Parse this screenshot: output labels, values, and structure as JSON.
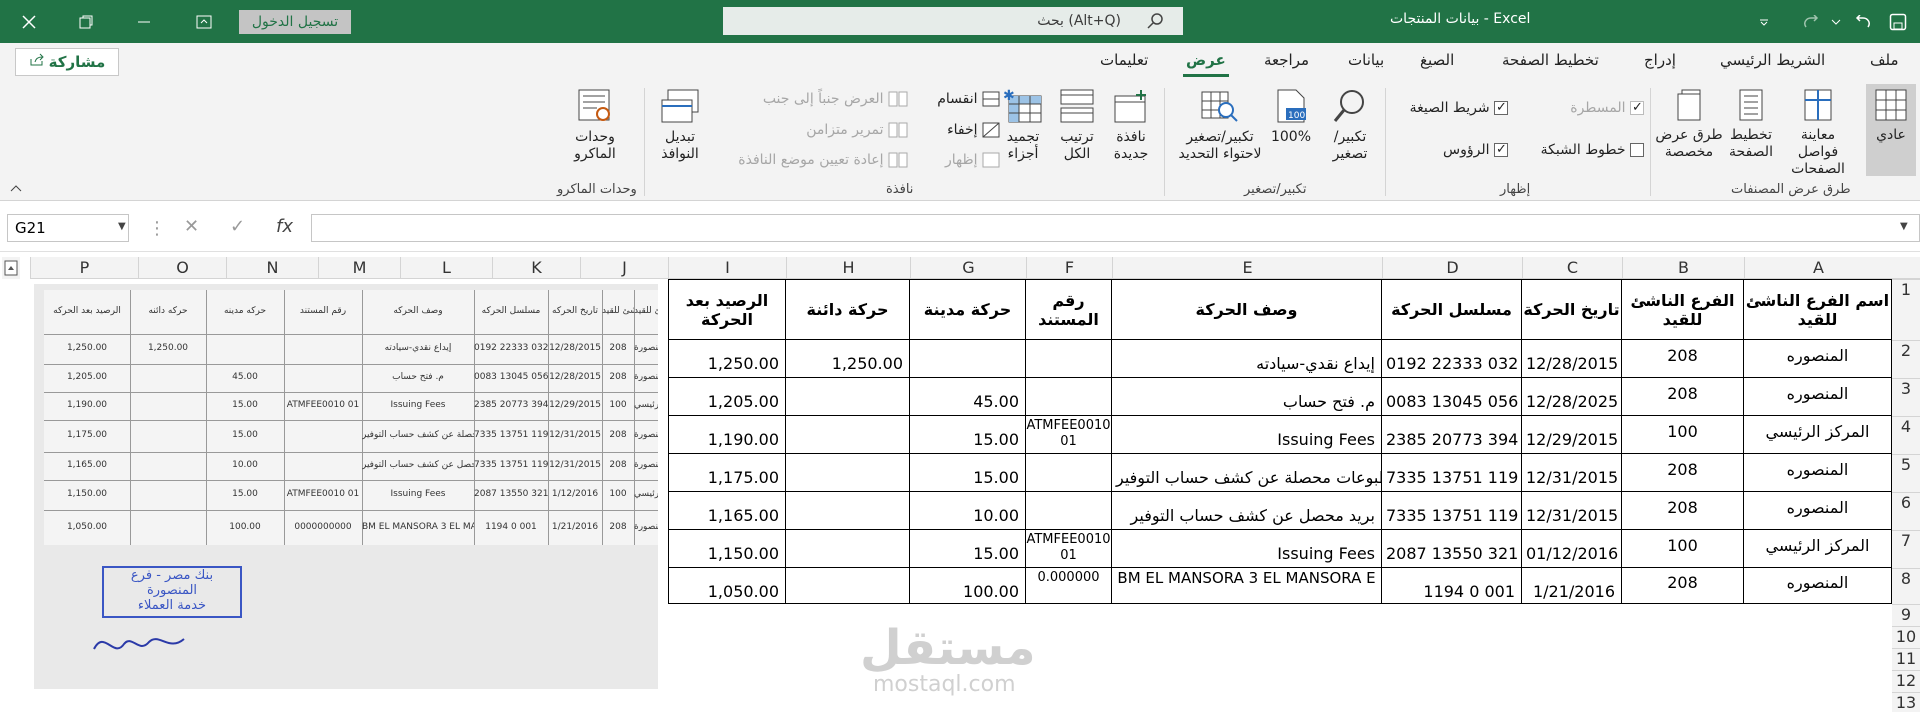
{
  "titlebar": {
    "title": "بيانات المنتجات  -  Excel",
    "search_text": "بحث (Alt+Q)",
    "login_label": "تسجيل الدخول"
  },
  "share_label": "مشاركة",
  "tabs": [
    {
      "label": "ملف"
    },
    {
      "label": "الشريط الرئيسي"
    },
    {
      "label": "إدراج"
    },
    {
      "label": "تخطيط الصفحة"
    },
    {
      "label": "الصيغ"
    },
    {
      "label": "بيانات"
    },
    {
      "label": "مراجعة"
    },
    {
      "label": "عرض"
    },
    {
      "label": "تعليمات"
    }
  ],
  "ribbon": {
    "normal": "عادي",
    "page_break": "معاينة فواصل الصفحات",
    "page_layout": "تخطيط الصفحة",
    "custom_views": "طرق عرض مخصصة",
    "group_views": "طرق عرض المصنفات",
    "ruler": "المسطرة",
    "formula_bar": "شريط الصيغة",
    "gridlines": "خطوط الشبكة",
    "headings": "الرؤوس",
    "group_show": "إظهار",
    "zoom": "تكبير/ تصغير",
    "zoom100": "100%",
    "zoom_selection": "تكبير/تصغير لاحتواء التحديد",
    "group_zoom": "تكبير/تصغير",
    "new_window": "نافذة جديدة",
    "arrange_all": "ترتيب الكل",
    "freeze": "تجميد أجزاء",
    "split": "انقسام",
    "hide": "إخفاء",
    "unhide": "إظهار",
    "side_by_side": "العرض جنباً إلى جنب",
    "sync_scroll": "تمرير متزامن",
    "reset_pos": "إعادة تعيين موضع النافذة",
    "switch_windows": "تبديل النوافذ",
    "group_window": "نافذة",
    "macros": "وحدات الماكرو",
    "group_macros": "وحدات الماكرو"
  },
  "namebox": "G21",
  "columns": [
    "A",
    "B",
    "C",
    "D",
    "E",
    "F",
    "G",
    "H",
    "I",
    "J",
    "K",
    "L",
    "M",
    "N",
    "O",
    "P"
  ],
  "rows": [
    "1",
    "2",
    "3",
    "4",
    "5",
    "6",
    "7",
    "8",
    "9",
    "10",
    "11",
    "12",
    "13"
  ],
  "table": {
    "headers": [
      "اسم الفرع الناشئ للقيد",
      "الفرع الناشئ للقيد",
      "تاريخ الحركة",
      "مسلسل الحركة",
      "وصف الحركة",
      "رقم المستند",
      "حركة مدينة",
      "حركة دائنة",
      "الرصيد بعد الحركة"
    ],
    "rows": [
      [
        "المنصوره",
        "208",
        "12/28/2015",
        "0192 22333 032",
        "إيداع نقدي-سيادته",
        "",
        "",
        "1,250.00",
        "1,250.00"
      ],
      [
        "المنصوره",
        "208",
        "12/28/2025",
        "0083 13045 056",
        "م. فتح حساب",
        "",
        "45.00",
        "",
        "1,205.00"
      ],
      [
        "المركز الرئيسي",
        "100",
        "12/29/2015",
        "2385 20773 394",
        "Issuing Fees",
        "ATMFEE0010 01",
        "15.00",
        "",
        "1,190.00"
      ],
      [
        "المنصوره",
        "208",
        "12/31/2015",
        "7335 13751 119",
        "مطبوعات محصلة عن كشف حساب التوفير",
        "",
        "15.00",
        "",
        "1,175.00"
      ],
      [
        "المنصوره",
        "208",
        "12/31/2015",
        "7335 13751 119",
        "بريد محصل عن كشف حساب التوفير",
        "",
        "10.00",
        "",
        "1,165.00"
      ],
      [
        "المركز الرئيسي",
        "100",
        "01/12/2016",
        "2087 13550 321",
        "Issuing Fees",
        "ATMFEE0010 01",
        "15.00",
        "",
        "1,150.00"
      ],
      [
        "المنصوره",
        "208",
        "1/21/2016",
        "1194 0 001",
        "BM EL MANSORA 3    EL MANSORA  E",
        "0.000000",
        "100.00",
        "",
        "1,050.00"
      ]
    ]
  },
  "scan": {
    "headers": [
      "الرصيد بعد الحركه",
      "حركه دائنه",
      "حركه مدينه",
      "رقم المستند",
      "وصف الحركه",
      "مسلسل الحركه",
      "تاريخ الحركه",
      "الفرع الناشئ للقيد",
      "اسم الفرع الناشئ للقيد"
    ],
    "rows": [
      [
        "1,250.00",
        "1,250.00",
        "",
        "",
        "إيداع نقدي-سيادته",
        "0192 22333 032",
        "12/28/2015",
        "208",
        "منصورة"
      ],
      [
        "1,205.00",
        "",
        "45.00",
        "",
        "م. فتح حساب",
        "0083 13045 056",
        "12/28/2015",
        "208",
        "منصورة"
      ],
      [
        "1,190.00",
        "",
        "15.00",
        "ATMFEE0010 01",
        "Issuing Fees",
        "2385 20773 394",
        "12/29/2015",
        "100",
        "كز الرئيسي"
      ],
      [
        "1,175.00",
        "",
        "15.00",
        "",
        "مطبوعات محصلة عن كشف حساب التوفير",
        "7335 13751 119",
        "12/31/2015",
        "208",
        "منصورة"
      ],
      [
        "1,165.00",
        "",
        "10.00",
        "",
        "بريد محصل عن كشف حساب التوفير",
        "7335 13751 119",
        "12/31/2015",
        "208",
        "منصورة"
      ],
      [
        "1,150.00",
        "",
        "15.00",
        "ATMFEE0010 01",
        "Issuing Fees",
        "2087 13550 321",
        "1/12/2016",
        "100",
        "كز الرئيسي"
      ],
      [
        "1,050.00",
        "",
        "100.00",
        "0000000000",
        "BM EL MANSORA 3   EL MANSORA   E",
        "1194 0 001",
        "1/21/2016",
        "208",
        "منصورة"
      ]
    ],
    "stamp_line1": "بنك مصر - فرع المنصورة",
    "stamp_line2": "خدمة العملاء"
  },
  "watermark": "مستقل",
  "watermark_sub": "mostaql.com"
}
